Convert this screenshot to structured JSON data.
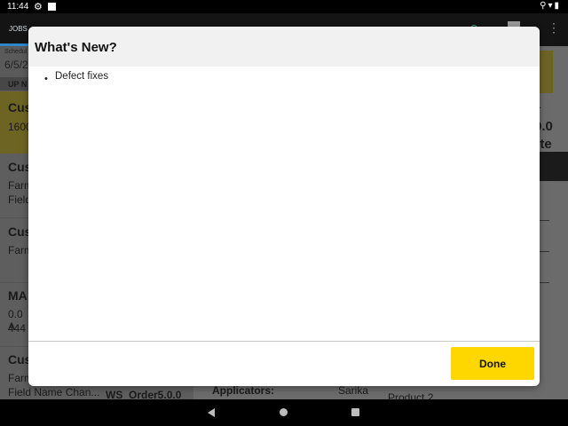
{
  "status_bar": {
    "time": "11:44"
  },
  "app_bar": {
    "tab_label": "JOBS"
  },
  "background": {
    "scheduled_label": "Schedul",
    "scheduled_date": "6/5/2",
    "up_next_label": "UP N",
    "selected_title": "Cus",
    "selected_sub": "1600",
    "list_items": [
      {
        "title": "Cus",
        "sub1": "Farm",
        "sub2": "Field"
      },
      {
        "title": "Cus",
        "sub1": "Farm",
        "sub2": ""
      },
      {
        "title": "MA",
        "sub1": "0.0 A",
        "sub2": "444"
      },
      {
        "title": "Cus",
        "sub1": "Farm",
        "sub2": "Field Name Chan..."
      }
    ],
    "order_text": "WS_Order5.0.0",
    "applicators_label": "Applicators:",
    "applicator_name": "Sarika",
    "product_label": "Product 2",
    "right_ob": "ob.",
    "right_big": "0.0",
    "right_ete": "ete",
    "right_s": "s"
  },
  "dialog": {
    "title": "What's New?",
    "items": [
      "Defect fixes"
    ],
    "done_label": "Done"
  },
  "colors": {
    "accent": "#ffd700",
    "tab_indicator": "#2f86c9"
  }
}
